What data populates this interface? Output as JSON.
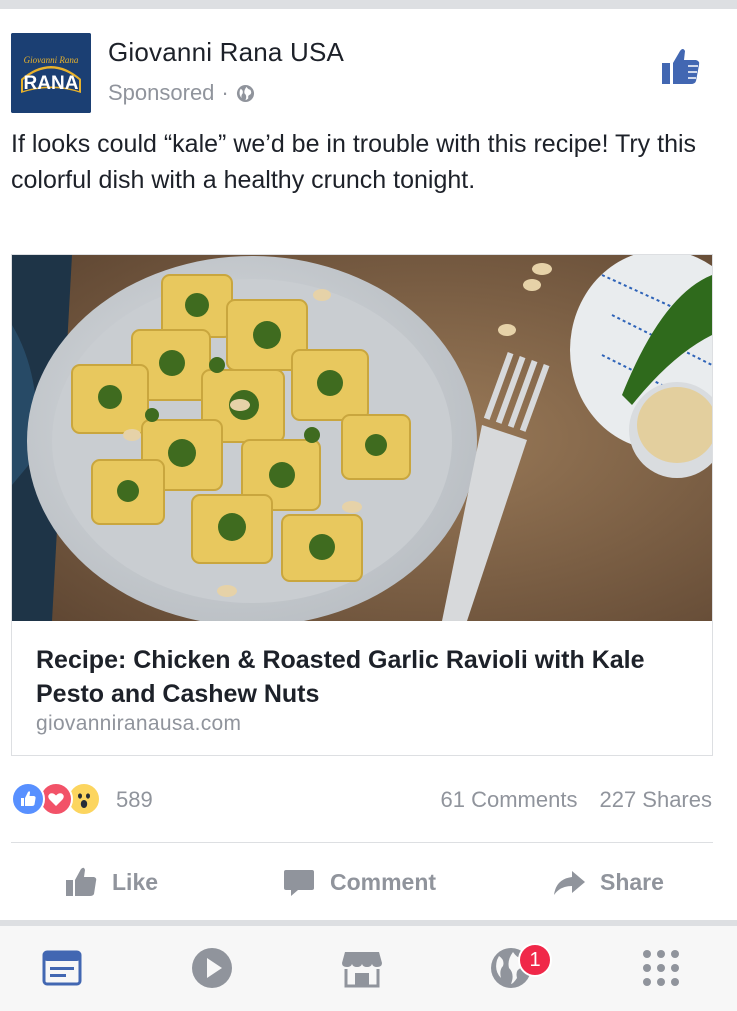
{
  "post": {
    "page_name": "Giovanni Rana USA",
    "sponsored": "Sponsored",
    "separator": "·",
    "avatar_logo_text": "RANA",
    "avatar_script_text": "Giovanni Rana",
    "text": "If looks could “kale” we’d be in trouble with this recipe! Try this colorful dish with a healthy crunch tonight.",
    "link": {
      "title": "Recipe: Chicken & Roasted Garlic Ravioli with Kale Pesto and Cashew Nuts",
      "domain": "giovanniranausa.com"
    },
    "reaction_count": "589",
    "comments": "61 Comments",
    "shares": "227 Shares"
  },
  "actions": {
    "like": "Like",
    "comment": "Comment",
    "share": "Share"
  },
  "tabbar": {
    "notifications_badge": "1",
    "items": [
      "news-feed",
      "video",
      "marketplace",
      "notifications",
      "menu"
    ]
  },
  "colors": {
    "brand_blue": "#4267b2",
    "tab_active": "#4267b2",
    "muted": "#90949c",
    "badge": "#f02849"
  }
}
